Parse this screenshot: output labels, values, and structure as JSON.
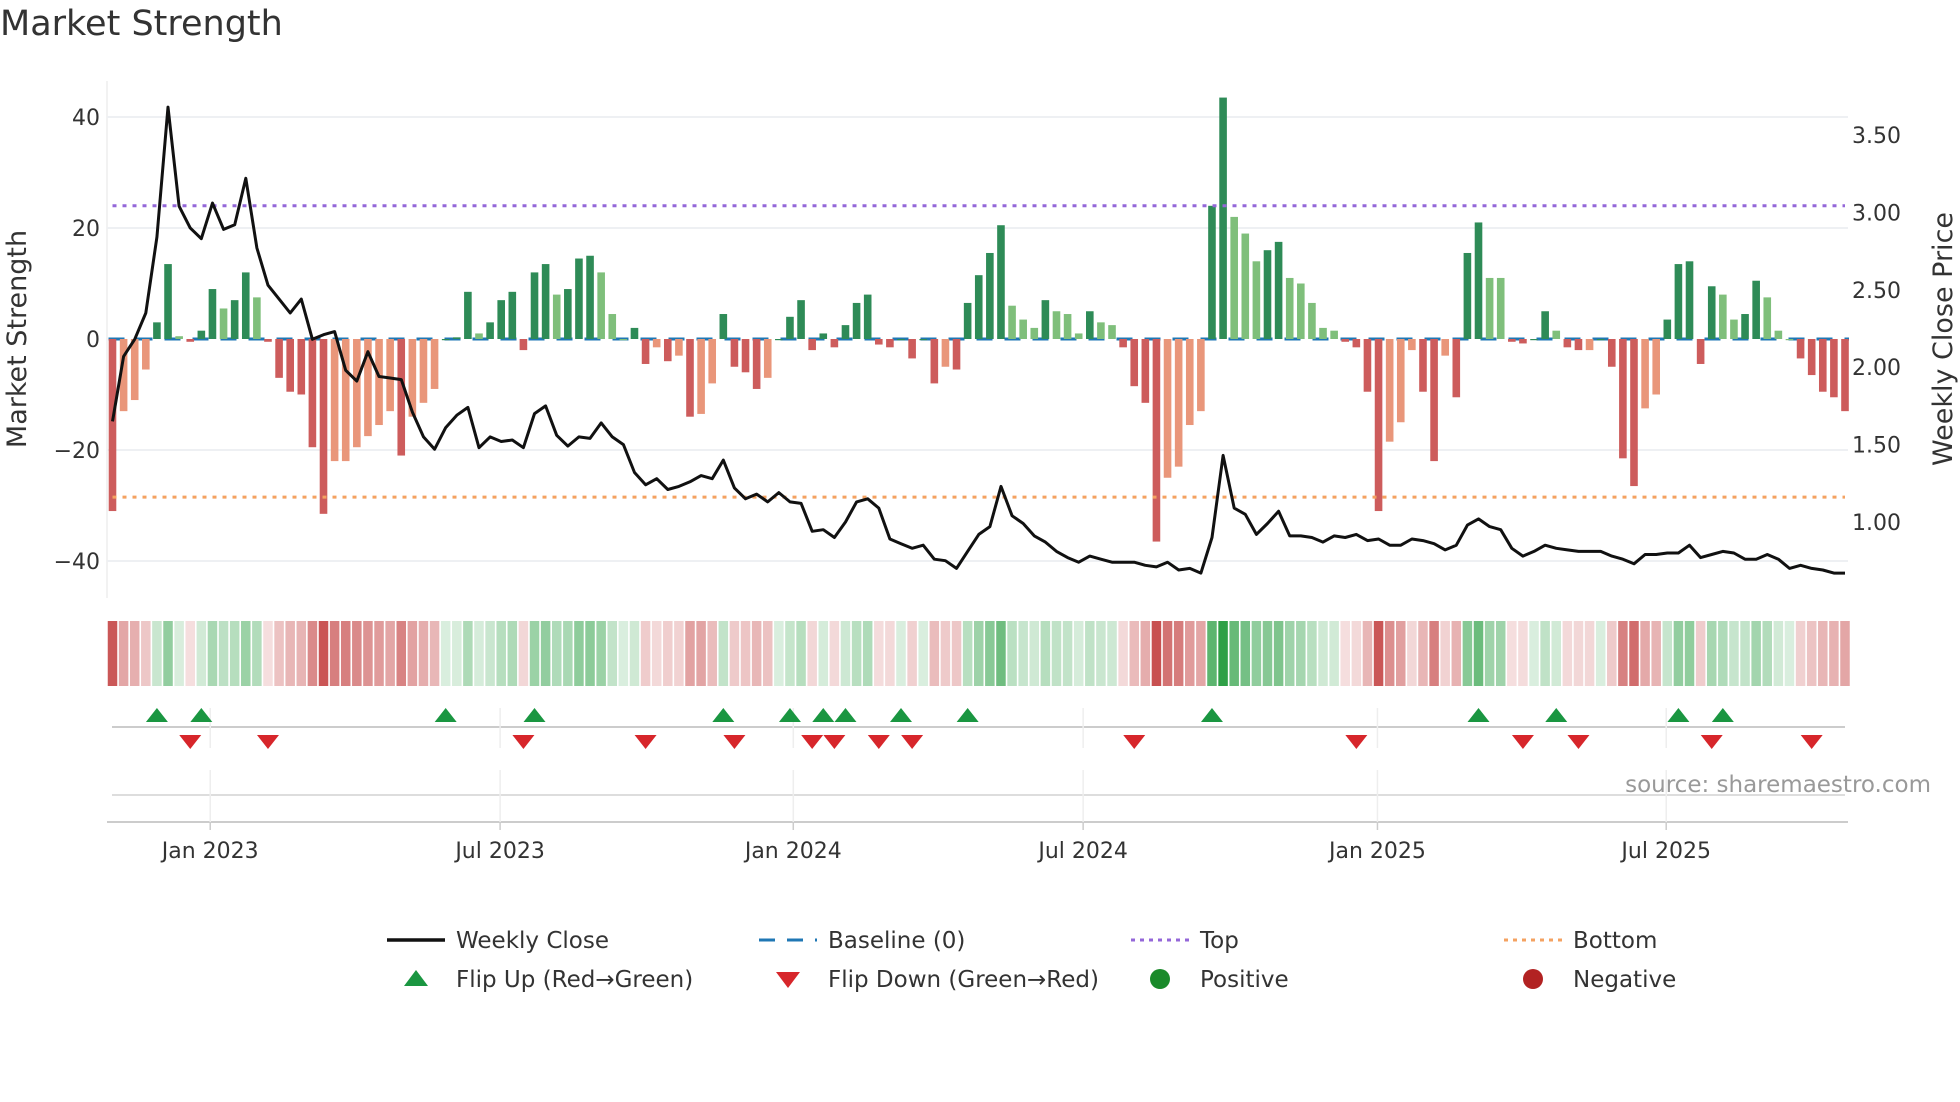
{
  "title": "Market Strength",
  "source": "source: sharemaestro.com",
  "colors": {
    "strong_green": "#2e8b57",
    "weak_green": "#7fbf7b",
    "strong_red": "#cd5c5c",
    "weak_red": "#e9967a",
    "close": "#111111",
    "baseline": "#1f77b4",
    "top": "#9467d9",
    "bottom": "#f4a261",
    "flip_up": "#1a9641",
    "flip_down": "#d7262b",
    "positive": "#1a8a2a",
    "negative": "#b22222"
  },
  "legend": [
    {
      "label": "Weekly Close",
      "icon": "solid-line"
    },
    {
      "label": "Baseline (0)",
      "icon": "dashed-line"
    },
    {
      "label": "Top",
      "icon": "dotted-line-purple"
    },
    {
      "label": "Bottom",
      "icon": "dotted-line-orange"
    },
    {
      "label": "Flip Up (Red→Green)",
      "icon": "triangle-up"
    },
    {
      "label": "Flip Down (Green→Red)",
      "icon": "triangle-down"
    },
    {
      "label": "Positive",
      "icon": "circle-green"
    },
    {
      "label": "Negative",
      "icon": "circle-red"
    }
  ],
  "chart_data": {
    "type": "bar",
    "title": "Market Strength",
    "ylabel": "Market Strength",
    "y2label": "Weekly Close Price",
    "ylim": [
      -47,
      47
    ],
    "y2lim": [
      0.63,
      3.75
    ],
    "yticks": [
      40,
      20,
      0,
      -20,
      -40
    ],
    "y2ticks": [
      "3.50",
      "3.00",
      "2.50",
      "2.00",
      "1.50",
      "1.00"
    ],
    "top_level": 24,
    "bottom_level": -28.5,
    "xticks": [
      {
        "label": "Jan 2023",
        "week": 8.8
      },
      {
        "label": "Jul 2023",
        "week": 34.9
      },
      {
        "label": "Jan 2024",
        "week": 61.3
      },
      {
        "label": "Jul 2024",
        "week": 87.4
      },
      {
        "label": "Jan 2025",
        "week": 113.9
      },
      {
        "label": "Jul 2025",
        "week": 139.9
      }
    ],
    "strength": [
      -31,
      -13,
      -11,
      -5.5,
      3,
      13.5,
      0.5,
      -0.5,
      1.5,
      9,
      5.5,
      7,
      12,
      7.5,
      -0.5,
      -7,
      -9.5,
      -10,
      -19.5,
      -31.5,
      -22,
      -22,
      -19.5,
      -17.5,
      -15.5,
      -13,
      -21,
      -14,
      -11.5,
      -9,
      0,
      0.3,
      8.5,
      1,
      3,
      7,
      8.5,
      -2,
      12,
      13.5,
      8,
      9,
      14.5,
      15,
      12,
      4.5,
      0,
      2,
      -4.5,
      -1.5,
      -4,
      -3,
      -14,
      -13.5,
      -8,
      4.5,
      -5,
      -6,
      -9,
      -7,
      0,
      4,
      7,
      -2,
      1,
      -1.5,
      2.5,
      6.5,
      8,
      -1,
      -1.5,
      0,
      -3.5,
      0,
      -8,
      -5,
      -5.5,
      6.5,
      11.5,
      15.5,
      20.5,
      6,
      3.5,
      2,
      7,
      5,
      4.5,
      1,
      5,
      3,
      2.5,
      -1.5,
      -8.5,
      -11.5,
      -36.5,
      -25,
      -23,
      -15.5,
      -13,
      24,
      43.5,
      22,
      19,
      14,
      16,
      17.5,
      11,
      10,
      6.5,
      2,
      1.5,
      -0.5,
      -1.5,
      -9.5,
      -31,
      -18.5,
      -15,
      -2,
      -9.5,
      -22,
      -3,
      -10.5,
      15.5,
      21,
      11,
      11,
      -0.5,
      -0.8,
      0,
      5,
      1.5,
      -1.5,
      -2,
      -2,
      0,
      -5,
      -21.5,
      -26.5,
      -12.5,
      -10,
      3.5,
      13.5,
      14,
      -4.5,
      9.5,
      8,
      3.5,
      4.5,
      10.5,
      7.5,
      1.5,
      0,
      -3.5,
      -6.5,
      -9.5,
      -10.5,
      -13
    ],
    "weekly_close": [
      1.65,
      2.07,
      2.18,
      2.35,
      2.84,
      3.68,
      3.04,
      2.9,
      2.83,
      3.06,
      2.89,
      2.92,
      3.22,
      2.77,
      2.53,
      2.44,
      2.35,
      2.44,
      2.18,
      2.21,
      2.23,
      1.98,
      1.91,
      2.1,
      1.94,
      1.93,
      1.92,
      1.71,
      1.55,
      1.47,
      1.61,
      1.69,
      1.74,
      1.48,
      1.55,
      1.52,
      1.53,
      1.48,
      1.7,
      1.75,
      1.56,
      1.49,
      1.55,
      1.54,
      1.64,
      1.55,
      1.5,
      1.32,
      1.24,
      1.28,
      1.21,
      1.23,
      1.26,
      1.3,
      1.28,
      1.4,
      1.22,
      1.15,
      1.18,
      1.13,
      1.19,
      1.13,
      1.12,
      0.94,
      0.95,
      0.9,
      1.0,
      1.13,
      1.15,
      1.09,
      0.89,
      0.86,
      0.83,
      0.85,
      0.76,
      0.75,
      0.7,
      0.81,
      0.92,
      0.97,
      1.23,
      1.04,
      0.99,
      0.91,
      0.87,
      0.81,
      0.77,
      0.74,
      0.78,
      0.76,
      0.74,
      0.74,
      0.74,
      0.72,
      0.71,
      0.74,
      0.69,
      0.7,
      0.67,
      0.9,
      1.43,
      1.09,
      1.05,
      0.92,
      0.99,
      1.07,
      0.91,
      0.91,
      0.9,
      0.87,
      0.91,
      0.9,
      0.92,
      0.88,
      0.89,
      0.85,
      0.85,
      0.89,
      0.88,
      0.86,
      0.82,
      0.85,
      0.98,
      1.02,
      0.97,
      0.95,
      0.83,
      0.78,
      0.81,
      0.85,
      0.83,
      0.82,
      0.81,
      0.81,
      0.81,
      0.78,
      0.76,
      0.73,
      0.79,
      0.79,
      0.8,
      0.8,
      0.85,
      0.77,
      0.79,
      0.81,
      0.8,
      0.76,
      0.76,
      0.79,
      0.76,
      0.7,
      0.72,
      0.7,
      0.69,
      0.67,
      0.67
    ],
    "flip_up_weeks": [
      4,
      8,
      30,
      38,
      55,
      61,
      64,
      66,
      71,
      77,
      99,
      123,
      130,
      141,
      145
    ],
    "flip_down_weeks": [
      7,
      14,
      37,
      48,
      56,
      63,
      65,
      69,
      72,
      92,
      112,
      127,
      132,
      144,
      153
    ],
    "legend_position": "bottom",
    "grid": true
  }
}
